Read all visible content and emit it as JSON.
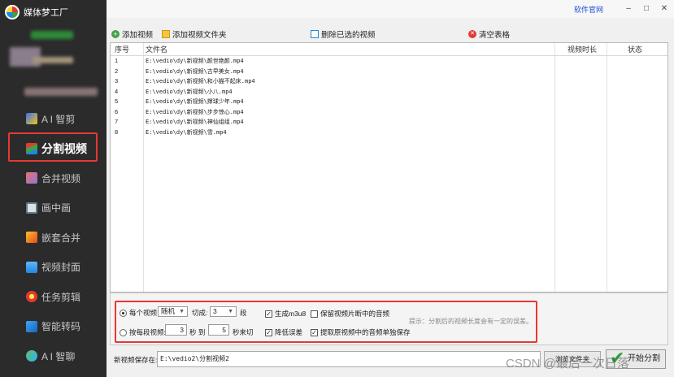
{
  "app": {
    "name": "媒体梦工厂",
    "official_site": "软件官网"
  },
  "window_controls": {
    "minimize": "–",
    "maximize": "□",
    "close": "✕"
  },
  "sidebar": {
    "items": [
      {
        "label": "A I 智剪",
        "icon": "ai-cut-icon"
      },
      {
        "label": "分割视频",
        "icon": "split-video-icon",
        "active": true
      },
      {
        "label": "合并视频",
        "icon": "merge-video-icon"
      },
      {
        "label": "画中画",
        "icon": "picture-in-picture-icon"
      },
      {
        "label": "嵌套合并",
        "icon": "nested-merge-icon"
      },
      {
        "label": "视频封面",
        "icon": "video-cover-icon"
      },
      {
        "label": "任务剪辑",
        "icon": "task-edit-icon"
      },
      {
        "label": "智能转码",
        "icon": "smart-transcode-icon"
      },
      {
        "label": "A I 智聊",
        "icon": "ai-chat-icon"
      }
    ]
  },
  "toolbar": {
    "add_video": "添加视频",
    "add_folder": "添加视频文件夹",
    "delete_selected": "删除已选的视频",
    "clear_table": "清空表格"
  },
  "table": {
    "headers": {
      "index": "序号",
      "filename": "文件名",
      "duration": "视频时长",
      "status": "状态"
    },
    "rows": [
      {
        "index": "1",
        "filename": "E:\\vedio\\dy\\新视频\\颜世绝颜.mp4"
      },
      {
        "index": "2",
        "filename": "E:\\vedio\\dy\\新视频\\古早美女.mp4"
      },
      {
        "index": "3",
        "filename": "E:\\vedio\\dy\\新视频\\和小猫不起床.mp4"
      },
      {
        "index": "4",
        "filename": "E:\\vedio\\dy\\新视频\\小八.mp4"
      },
      {
        "index": "5",
        "filename": "E:\\vedio\\dy\\新视频\\撑球少年.mp4"
      },
      {
        "index": "6",
        "filename": "E:\\vedio\\dy\\新视频\\步步惊心.mp4"
      },
      {
        "index": "7",
        "filename": "E:\\vedio\\dy\\新视频\\神仙组组.mp4"
      },
      {
        "index": "8",
        "filename": "E:\\vedio\\dy\\新视频\\雪.mp4"
      }
    ]
  },
  "options": {
    "per_video": "每个视频",
    "mode_value": "随机",
    "cut_into": "切成:",
    "segments_value": "3",
    "segments_unit": "段",
    "by_segment": "按每段视频:",
    "from_value": "3",
    "sec_to": "秒 到",
    "to_value": "5",
    "sec_cut": "秒来切",
    "gen_m3u8": "生成m3u8",
    "reduce_loss": "降低误差",
    "keep_audio": "保留视频片断中的音频",
    "extract_audio": "提取原视频中的音频单独保存",
    "hint": "提示：分割后的视频长度会有一定的误差。"
  },
  "save": {
    "label": "新视频保存在:",
    "path": "E:\\vedio2\\分割视频2",
    "browse": "浏览文件夹",
    "start": "开始分割"
  },
  "watermark": "CSDN @最后一次日落",
  "colors": {
    "sidebar_bg": "#2b2b2b",
    "highlight": "#e53935",
    "link": "#1a4fd6"
  }
}
